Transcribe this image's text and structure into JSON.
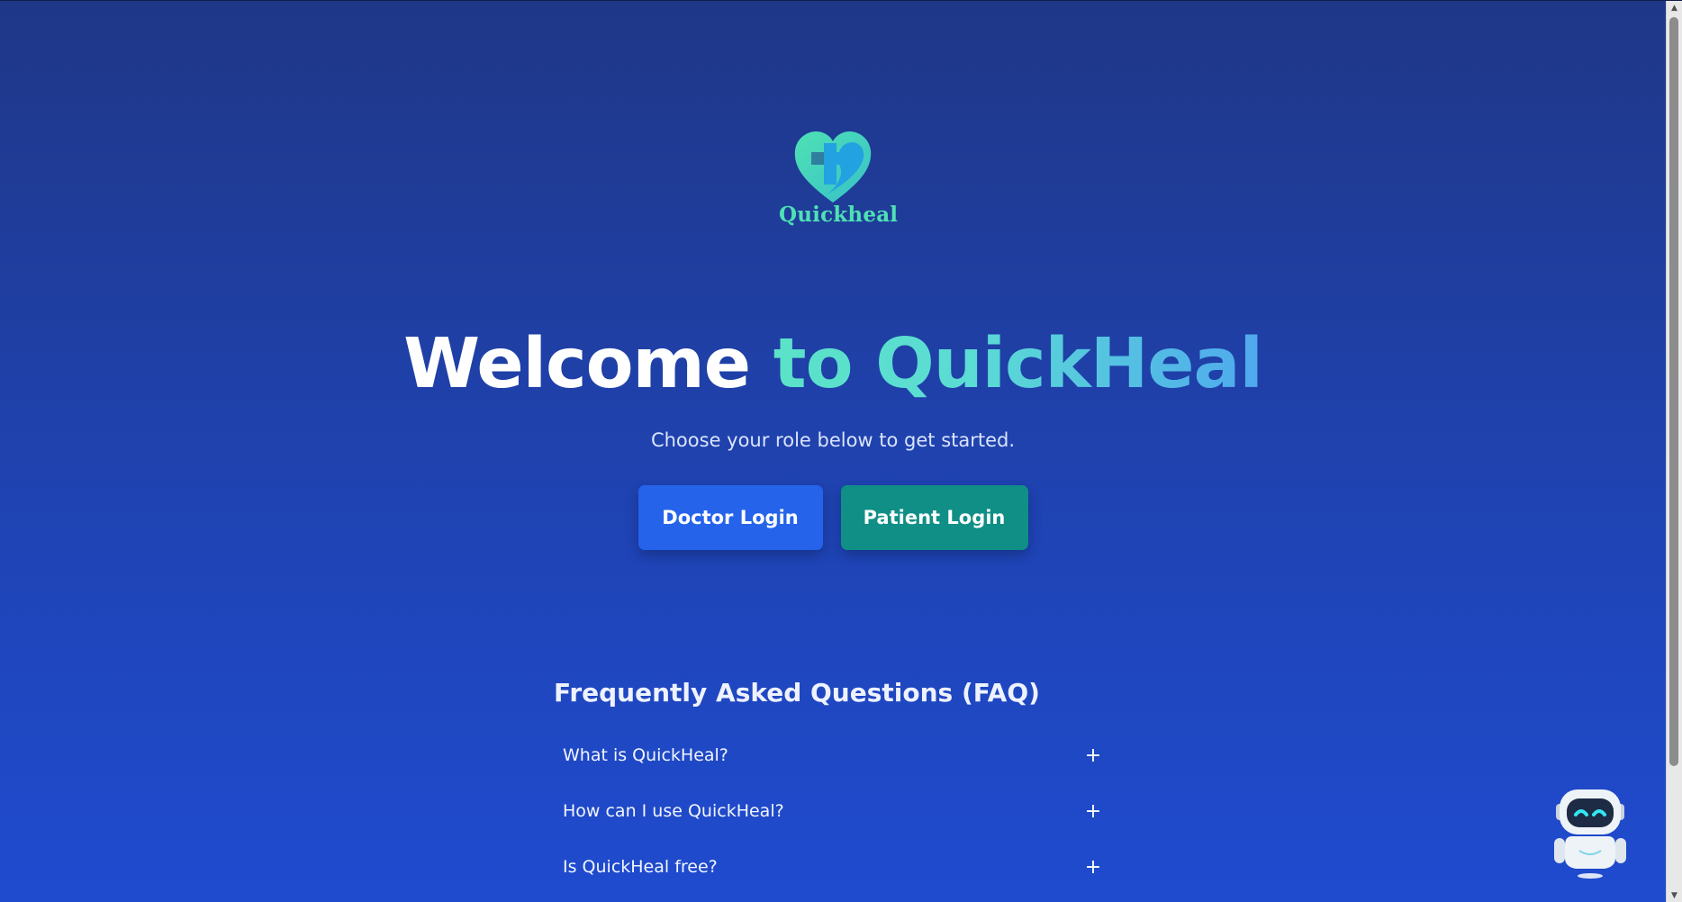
{
  "brand": {
    "logo_text": "Quickheal",
    "logo_colors": [
      "#4fe1b4",
      "#22a2e0"
    ]
  },
  "hero": {
    "title_part1": "Welcome",
    "title_part2": "to QuickHeal",
    "subtitle": "Choose your role below to get started."
  },
  "buttons": {
    "doctor_label": "Doctor Login",
    "patient_label": "Patient Login",
    "doctor_color": "#2563eb",
    "patient_color": "#0f8f86"
  },
  "faq": {
    "title": "Frequently Asked Questions (FAQ)",
    "items": [
      {
        "question": "What is QuickHeal?",
        "icon": "+"
      },
      {
        "question": "How can I use QuickHeal?",
        "icon": "+"
      },
      {
        "question": "Is QuickHeal free?",
        "icon": "+"
      }
    ]
  },
  "chatbot": {
    "icon": "robot-icon"
  },
  "scrollbar": {
    "up_arrow": "▲",
    "down_arrow": "▼"
  }
}
